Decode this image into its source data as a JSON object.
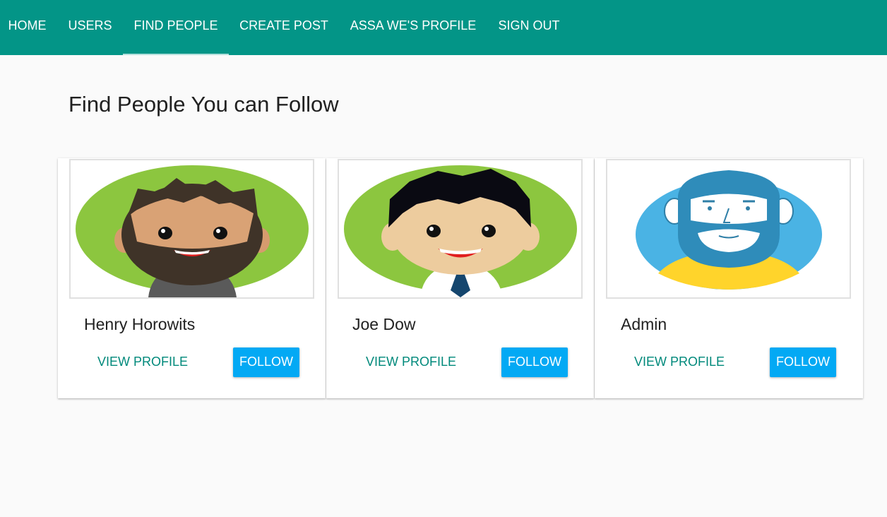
{
  "nav": {
    "items": [
      {
        "label": "HOME"
      },
      {
        "label": "USERS"
      },
      {
        "label": "FIND PEOPLE",
        "active": true
      },
      {
        "label": "CREATE POST"
      },
      {
        "label": "ASSA WE'S PROFILE"
      },
      {
        "label": "SIGN OUT"
      }
    ]
  },
  "page": {
    "title": "Find People You can Follow"
  },
  "people": [
    {
      "name": "Henry Horowits",
      "view_label": "VIEW PROFILE",
      "follow_label": "FOLLOW",
      "avatar": "bearded-man-avatar-icon"
    },
    {
      "name": "Joe Dow",
      "view_label": "VIEW PROFILE",
      "follow_label": "FOLLOW",
      "avatar": "office-man-avatar-icon"
    },
    {
      "name": "Admin",
      "view_label": "VIEW PROFILE",
      "follow_label": "FOLLOW",
      "avatar": "blue-bearded-avatar-icon"
    }
  ],
  "colors": {
    "appbar": "#039587",
    "follow_button": "#03a9f4",
    "view_profile_text": "#00897b",
    "page_background": "#fafafa"
  }
}
